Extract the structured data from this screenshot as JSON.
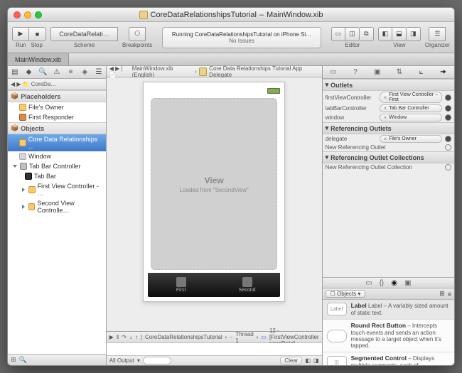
{
  "window": {
    "title_prefix": "CoreDataRelationshipsTutorial",
    "title_file": "MainWindow.xib"
  },
  "toolbar": {
    "run": "Run",
    "stop": "Stop",
    "scheme": "Scheme",
    "scheme_value": "CoreDataRelati…",
    "breakpoints": "Breakpoints",
    "activity_line1": "Running CoreDataRelationshipsTutorial on iPhone Si…",
    "activity_line2": "No Issues",
    "editor": "Editor",
    "view": "View",
    "organizer": "Organizer"
  },
  "tab": {
    "name": "MainWindow.xib"
  },
  "nav_crumb": {
    "folder": "CoreDa…"
  },
  "outline": {
    "placeholders_hdr": "Placeholders",
    "files_owner": "File's Owner",
    "first_responder": "First Responder",
    "objects_hdr": "Objects",
    "selected": "Core Data Relationships …",
    "window": "Window",
    "tabbarctrl": "Tab Bar Controller",
    "tabbar": "Tab Bar",
    "firstvc": "First View Controller - …",
    "secondvc": "Second View Controlle…"
  },
  "jump": {
    "file": "MainWindow.xib (English)",
    "delegate": "Core Data Relationships Tutorial App Delegate"
  },
  "canvas": {
    "view_title": "View",
    "view_sub": "Loaded from \"SecondView\"",
    "tab1": "First",
    "tab2": "Second"
  },
  "debug": {
    "proj": "CoreDataRelationshipsTutorial",
    "thread": "Thread 1",
    "frame": "12 -[FirstViewController saveData]",
    "all_output": "All Output",
    "clear": "Clear"
  },
  "inspector": {
    "outlets_hdr": "Outlets",
    "o1_label": "firstViewController",
    "o1_dest": "First View Controller – First",
    "o2_label": "tabBarController",
    "o2_dest": "Tab Bar Controller",
    "o3_label": "window",
    "o3_dest": "Window",
    "ref_outlets_hdr": "Referencing Outlets",
    "r1_label": "delegate",
    "r1_dest": "File's Owner",
    "r2_label": "New Referencing Outlet",
    "ref_coll_hdr": "Referencing Outlet Collections",
    "c1_label": "New Referencing Outlet Collection"
  },
  "library": {
    "header": "Objects",
    "label_title": "Label",
    "label_desc": "Label – A variably sized amount of static text.",
    "button_title": "Round Rect Button",
    "button_desc": " – Intercepts touch events and sends an action message to a target object when it's tapped.",
    "seg_title": "Segmented Control",
    "seg_desc": " – Displays multiple segments, each of"
  }
}
